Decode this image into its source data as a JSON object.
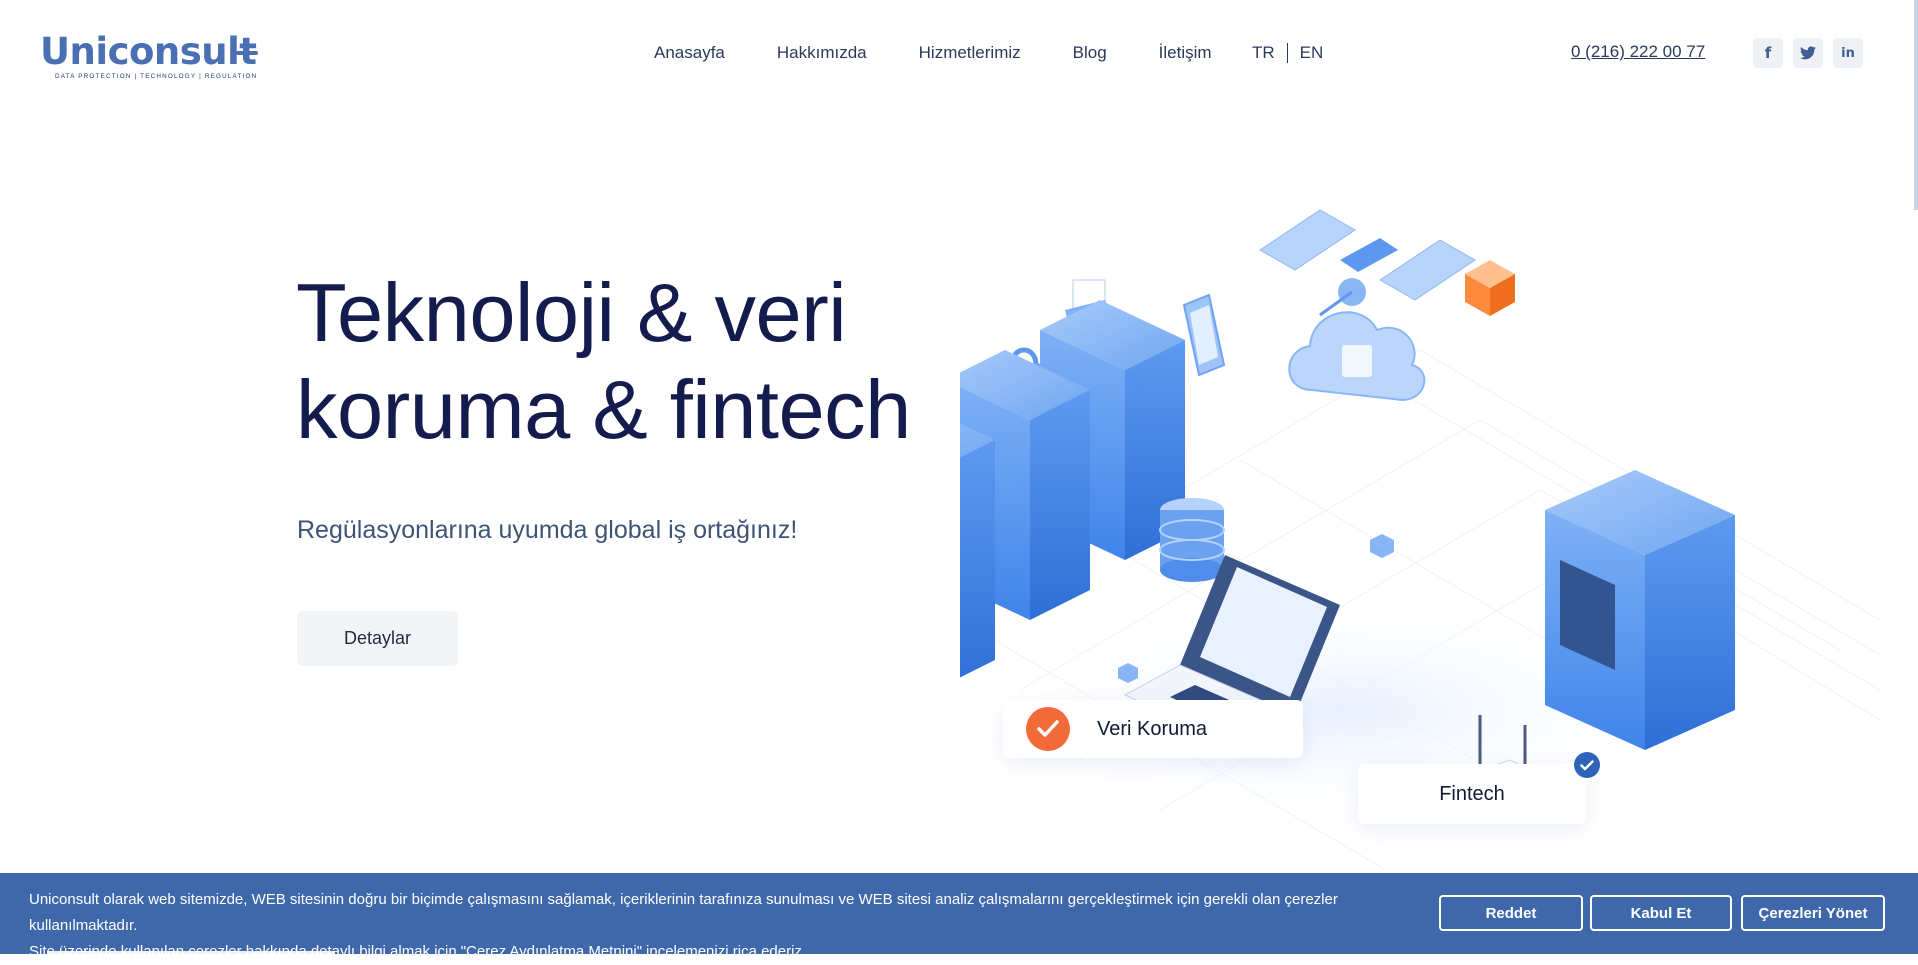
{
  "brand": {
    "name": "Uniconsult",
    "tagline": "DATA PROTECTION | TECHNOLOGY | REGULATION",
    "accent": "#4a6fb2"
  },
  "nav": {
    "items": [
      {
        "label": "Anasayfa"
      },
      {
        "label": "Hakkımızda"
      },
      {
        "label": "Hizmetlerimiz"
      },
      {
        "label": "Blog"
      },
      {
        "label": "İletişim"
      }
    ]
  },
  "lang": {
    "tr": "TR",
    "en": "EN"
  },
  "contact": {
    "phone": "0 (216) 222 00 77"
  },
  "social": {
    "facebook": {
      "icon": "facebook-icon",
      "glyph": "f"
    },
    "twitter": {
      "icon": "twitter-icon"
    },
    "linkedin": {
      "icon": "linkedin-icon",
      "glyph": "in"
    }
  },
  "hero": {
    "title_line1": "Teknoloji & veri",
    "title_line2": "koruma & fintech",
    "subtitle": "Regülasyonlarına uyumda global iş ortağınız!",
    "cta_label": "Detaylar"
  },
  "badges": {
    "veri": "Veri Koruma",
    "fintech": "Fintech"
  },
  "cookie": {
    "text_line1": "Uniconsult olarak web sitemizde, WEB sitesinin doğru bir biçimde çalışmasını sağlamak, içeriklerinin tarafınıza sunulması ve WEB sitesi analiz çalışmalarını gerçekleştirmek için gerekli olan çerezler kullanılmaktadır.",
    "text_line2_pre": "Site üzerinde kullanılan çerezler hakkında detaylı bilgi almak için",
    "link_label": "\"Çerez Aydınlatma Metnini\"",
    "text_line2_post": "incelemenizi rica ederiz.",
    "reject_label": "Reddet",
    "accept_label": "Kabul Et",
    "manage_label": "Çerezleri Yönet",
    "bar_color": "#3f68ab"
  },
  "colors": {
    "title": "#141b4d",
    "orange": "#f46b3a",
    "blue_check": "#2e64b8"
  }
}
